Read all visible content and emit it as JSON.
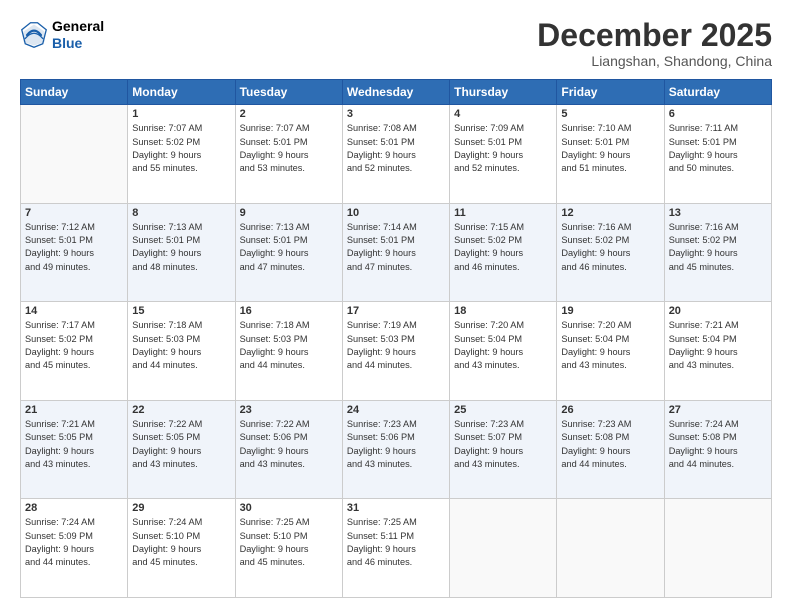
{
  "logo": {
    "general": "General",
    "blue": "Blue"
  },
  "header": {
    "month": "December 2025",
    "location": "Liangshan, Shandong, China"
  },
  "weekdays": [
    "Sunday",
    "Monday",
    "Tuesday",
    "Wednesday",
    "Thursday",
    "Friday",
    "Saturday"
  ],
  "weeks": [
    [
      {
        "day": "",
        "info": ""
      },
      {
        "day": "1",
        "info": "Sunrise: 7:07 AM\nSunset: 5:02 PM\nDaylight: 9 hours\nand 55 minutes."
      },
      {
        "day": "2",
        "info": "Sunrise: 7:07 AM\nSunset: 5:01 PM\nDaylight: 9 hours\nand 53 minutes."
      },
      {
        "day": "3",
        "info": "Sunrise: 7:08 AM\nSunset: 5:01 PM\nDaylight: 9 hours\nand 52 minutes."
      },
      {
        "day": "4",
        "info": "Sunrise: 7:09 AM\nSunset: 5:01 PM\nDaylight: 9 hours\nand 52 minutes."
      },
      {
        "day": "5",
        "info": "Sunrise: 7:10 AM\nSunset: 5:01 PM\nDaylight: 9 hours\nand 51 minutes."
      },
      {
        "day": "6",
        "info": "Sunrise: 7:11 AM\nSunset: 5:01 PM\nDaylight: 9 hours\nand 50 minutes."
      }
    ],
    [
      {
        "day": "7",
        "info": "Sunrise: 7:12 AM\nSunset: 5:01 PM\nDaylight: 9 hours\nand 49 minutes."
      },
      {
        "day": "8",
        "info": "Sunrise: 7:13 AM\nSunset: 5:01 PM\nDaylight: 9 hours\nand 48 minutes."
      },
      {
        "day": "9",
        "info": "Sunrise: 7:13 AM\nSunset: 5:01 PM\nDaylight: 9 hours\nand 47 minutes."
      },
      {
        "day": "10",
        "info": "Sunrise: 7:14 AM\nSunset: 5:01 PM\nDaylight: 9 hours\nand 47 minutes."
      },
      {
        "day": "11",
        "info": "Sunrise: 7:15 AM\nSunset: 5:02 PM\nDaylight: 9 hours\nand 46 minutes."
      },
      {
        "day": "12",
        "info": "Sunrise: 7:16 AM\nSunset: 5:02 PM\nDaylight: 9 hours\nand 46 minutes."
      },
      {
        "day": "13",
        "info": "Sunrise: 7:16 AM\nSunset: 5:02 PM\nDaylight: 9 hours\nand 45 minutes."
      }
    ],
    [
      {
        "day": "14",
        "info": "Sunrise: 7:17 AM\nSunset: 5:02 PM\nDaylight: 9 hours\nand 45 minutes."
      },
      {
        "day": "15",
        "info": "Sunrise: 7:18 AM\nSunset: 5:03 PM\nDaylight: 9 hours\nand 44 minutes."
      },
      {
        "day": "16",
        "info": "Sunrise: 7:18 AM\nSunset: 5:03 PM\nDaylight: 9 hours\nand 44 minutes."
      },
      {
        "day": "17",
        "info": "Sunrise: 7:19 AM\nSunset: 5:03 PM\nDaylight: 9 hours\nand 44 minutes."
      },
      {
        "day": "18",
        "info": "Sunrise: 7:20 AM\nSunset: 5:04 PM\nDaylight: 9 hours\nand 43 minutes."
      },
      {
        "day": "19",
        "info": "Sunrise: 7:20 AM\nSunset: 5:04 PM\nDaylight: 9 hours\nand 43 minutes."
      },
      {
        "day": "20",
        "info": "Sunrise: 7:21 AM\nSunset: 5:04 PM\nDaylight: 9 hours\nand 43 minutes."
      }
    ],
    [
      {
        "day": "21",
        "info": "Sunrise: 7:21 AM\nSunset: 5:05 PM\nDaylight: 9 hours\nand 43 minutes."
      },
      {
        "day": "22",
        "info": "Sunrise: 7:22 AM\nSunset: 5:05 PM\nDaylight: 9 hours\nand 43 minutes."
      },
      {
        "day": "23",
        "info": "Sunrise: 7:22 AM\nSunset: 5:06 PM\nDaylight: 9 hours\nand 43 minutes."
      },
      {
        "day": "24",
        "info": "Sunrise: 7:23 AM\nSunset: 5:06 PM\nDaylight: 9 hours\nand 43 minutes."
      },
      {
        "day": "25",
        "info": "Sunrise: 7:23 AM\nSunset: 5:07 PM\nDaylight: 9 hours\nand 43 minutes."
      },
      {
        "day": "26",
        "info": "Sunrise: 7:23 AM\nSunset: 5:08 PM\nDaylight: 9 hours\nand 44 minutes."
      },
      {
        "day": "27",
        "info": "Sunrise: 7:24 AM\nSunset: 5:08 PM\nDaylight: 9 hours\nand 44 minutes."
      }
    ],
    [
      {
        "day": "28",
        "info": "Sunrise: 7:24 AM\nSunset: 5:09 PM\nDaylight: 9 hours\nand 44 minutes."
      },
      {
        "day": "29",
        "info": "Sunrise: 7:24 AM\nSunset: 5:10 PM\nDaylight: 9 hours\nand 45 minutes."
      },
      {
        "day": "30",
        "info": "Sunrise: 7:25 AM\nSunset: 5:10 PM\nDaylight: 9 hours\nand 45 minutes."
      },
      {
        "day": "31",
        "info": "Sunrise: 7:25 AM\nSunset: 5:11 PM\nDaylight: 9 hours\nand 46 minutes."
      },
      {
        "day": "",
        "info": ""
      },
      {
        "day": "",
        "info": ""
      },
      {
        "day": "",
        "info": ""
      }
    ]
  ]
}
